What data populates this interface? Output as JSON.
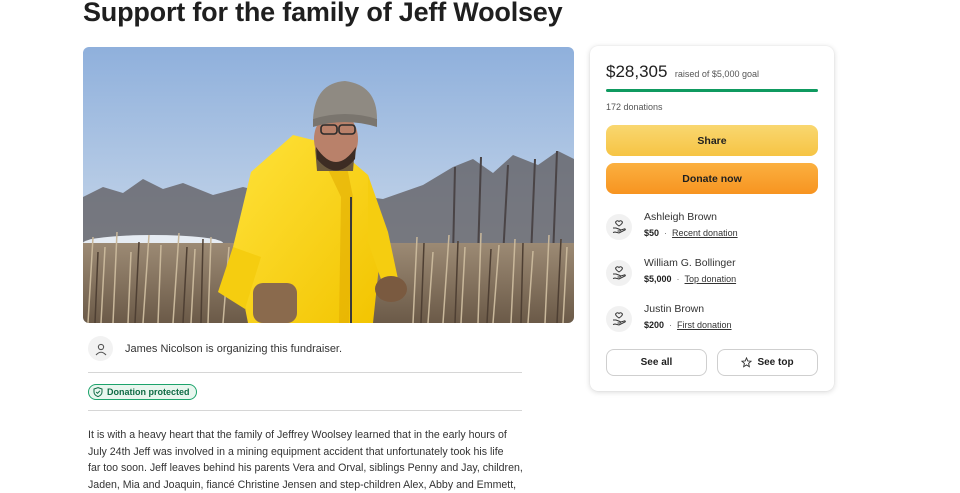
{
  "campaign": {
    "title": "Support for the family of Jeff Woolsey"
  },
  "organizer": {
    "text": "James Nicolson is organizing this fundraiser."
  },
  "badge": {
    "label": "Donation protected"
  },
  "story": {
    "lines": [
      "It is with a heavy heart that the family of Jeffrey Woolsey learned that in the early hours of",
      "July 24th Jeff was involved in a mining equipment accident that unfortunately took his life",
      "far too soon. Jeff leaves behind his parents Vera and Orval, siblings Penny and Jay, children,",
      "Jaden, Mia and Joaquin, fiancé Christine Jensen and step-children Alex, Abby and Emmett,"
    ]
  },
  "donation_card": {
    "raised": "$28,305",
    "goal_text": "raised of $5,000 goal",
    "progress_fraction": 1.0,
    "donations_text": "172 donations",
    "share_label": "Share",
    "donate_label": "Donate now",
    "donors": [
      {
        "name": "Ashleigh Brown",
        "amount": "$50",
        "tag": "Recent donation"
      },
      {
        "name": "William G. Bollinger",
        "amount": "$5,000",
        "tag": "Top donation"
      },
      {
        "name": "Justin Brown",
        "amount": "$200",
        "tag": "First donation"
      }
    ],
    "see_all_label": "See all",
    "see_top_label": "See top",
    "icons": {
      "donor": "donation-hand-icon",
      "see_top": "star-icon",
      "organizer": "user-icon",
      "badge": "shield-check-icon"
    },
    "colors": {
      "progress": "#0f9a60",
      "share": "#f7c94f",
      "donate": "#f89a2c"
    }
  }
}
